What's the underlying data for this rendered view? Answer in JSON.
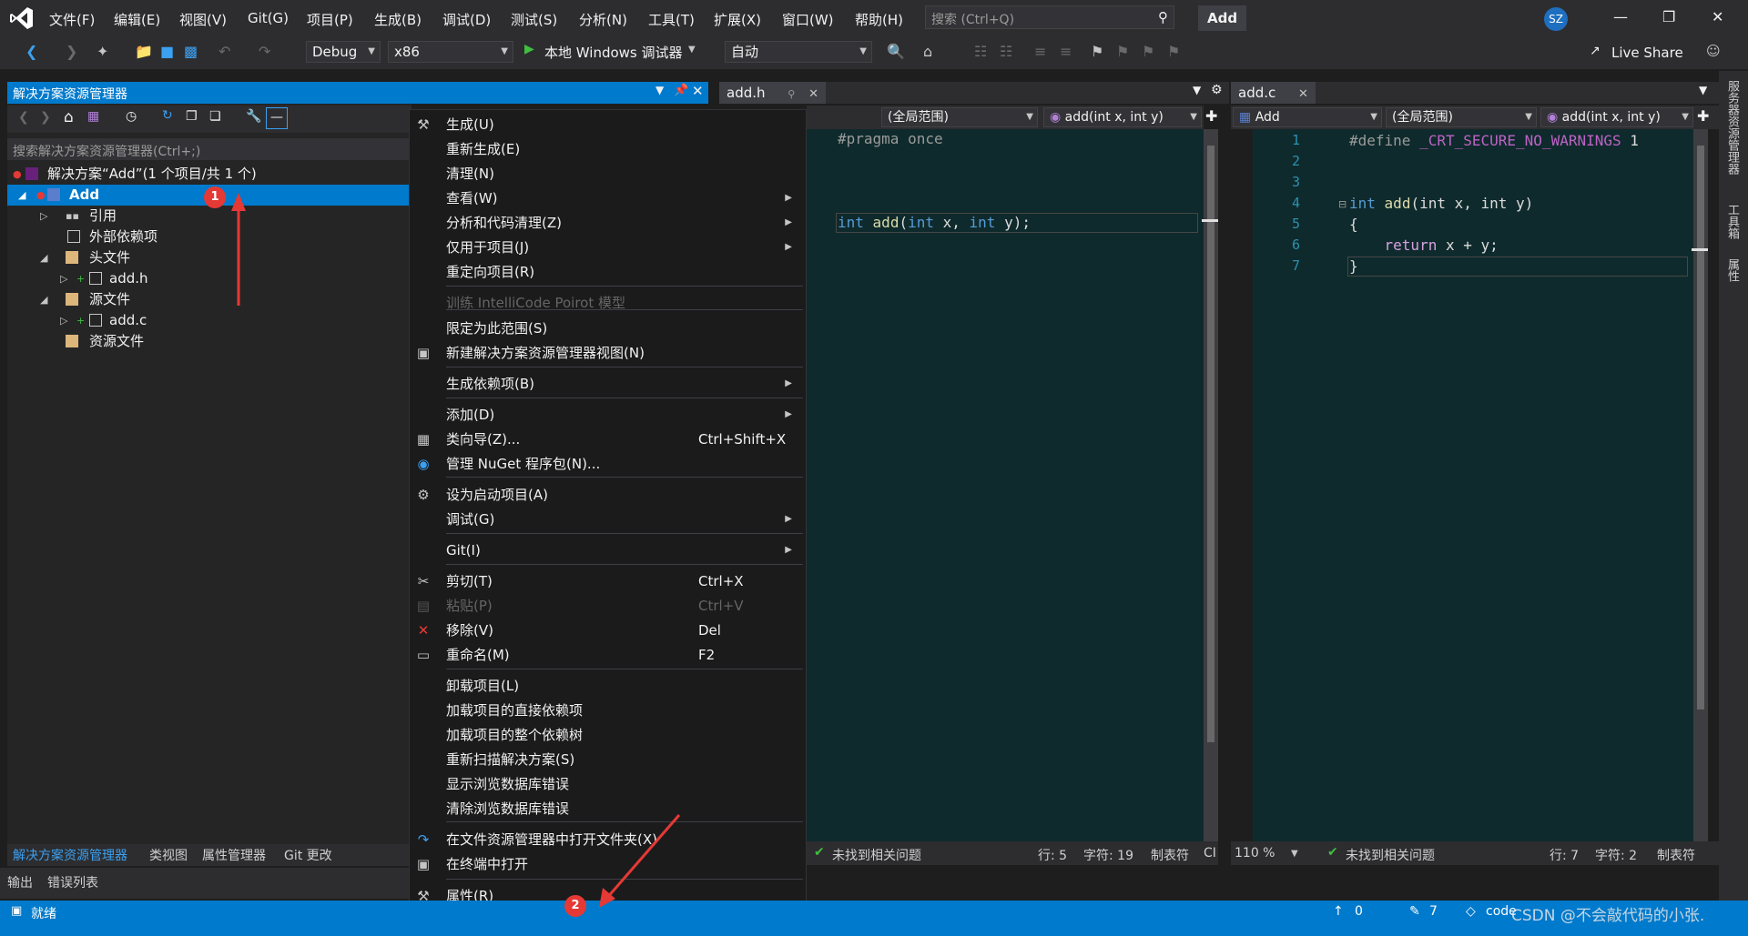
{
  "menubar": {
    "items": [
      "文件(F)",
      "编辑(E)",
      "视图(V)",
      "Git(G)",
      "项目(P)",
      "生成(B)",
      "调试(D)",
      "测试(S)",
      "分析(N)",
      "工具(T)",
      "扩展(X)",
      "窗口(W)",
      "帮助(H)"
    ],
    "search_placeholder": "搜索 (Ctrl+Q)",
    "solution_name": "Add",
    "avatar": "SZ"
  },
  "toolbar": {
    "config": "Debug",
    "platform": "x86",
    "run_label": "本地 Windows 调试器",
    "auto": "自动",
    "live_share": "Live Share"
  },
  "solution_explorer": {
    "title": "解决方案资源管理器",
    "search_placeholder": "搜索解决方案资源管理器(Ctrl+;)",
    "tree": [
      {
        "label": "解决方案“Add”(1 个项目/共 1 个)"
      },
      {
        "label": "Add"
      },
      {
        "label": "引用"
      },
      {
        "label": "外部依赖项"
      },
      {
        "label": "头文件"
      },
      {
        "label": "add.h"
      },
      {
        "label": "源文件"
      },
      {
        "label": "add.c"
      },
      {
        "label": "资源文件"
      }
    ],
    "tabs": [
      "解决方案资源管理器",
      "类视图",
      "属性管理器",
      "Git 更改"
    ]
  },
  "bottom_tabs": [
    "输出",
    "错误列表"
  ],
  "editor_left": {
    "tab": "add.h",
    "scope": "(全局范围)",
    "func": "add(int x, int y)",
    "lines": [
      "#pragma once",
      "int add(int x, int y);"
    ],
    "status": "未找到相关问题",
    "row": "行: 5",
    "col": "字符: 19",
    "tabs_mode": "制表符",
    "crlf": "CI"
  },
  "editor_right": {
    "tab": "add.c",
    "project": "Add",
    "scope": "(全局范围)",
    "func": "add(int x, int y)",
    "line_numbers": [
      "1",
      "2",
      "3",
      "4",
      "5",
      "6",
      "7"
    ],
    "line1_directive": "#define",
    "line1_macro": "_CRT_SECURE_NO_WARNINGS",
    "line1_value": "1",
    "line4_kw": "int",
    "line4_fn": "add",
    "line4_rest": "(int x, int y)",
    "line5": "{",
    "line6_kw": "return",
    "line6_rest": " x + y;",
    "line7": "}",
    "zoom": "110 %",
    "status": "未找到相关问题",
    "row": "行: 7",
    "col": "字符: 2",
    "tabs_mode": "制表符"
  },
  "context_menu": {
    "items": [
      {
        "label": "生成(U)",
        "icon": "build-icon"
      },
      {
        "label": "重新生成(E)"
      },
      {
        "label": "清理(N)"
      },
      {
        "label": "查看(W)",
        "submenu": true
      },
      {
        "label": "分析和代码清理(Z)",
        "submenu": true
      },
      {
        "label": "仅用于项目(J)",
        "submenu": true
      },
      {
        "label": "重定向项目(R)"
      },
      {
        "label": "训练 IntelliCode Poirot 模型",
        "disabled": true
      },
      {
        "label": "限定为此范围(S)"
      },
      {
        "label": "新建解决方案资源管理器视图(N)",
        "icon": "new-view-icon"
      },
      {
        "label": "生成依赖项(B)",
        "submenu": true
      },
      {
        "label": "添加(D)",
        "submenu": true
      },
      {
        "label": "类向导(Z)...",
        "shortcut": "Ctrl+Shift+X",
        "icon": "class-wizard-icon"
      },
      {
        "label": "管理 NuGet 程序包(N)...",
        "icon": "nuget-icon"
      },
      {
        "label": "设为启动项目(A)",
        "icon": "gear-icon"
      },
      {
        "label": "调试(G)",
        "submenu": true
      },
      {
        "label": "Git(I)",
        "submenu": true
      },
      {
        "label": "剪切(T)",
        "shortcut": "Ctrl+X",
        "icon": "cut-icon"
      },
      {
        "label": "粘贴(P)",
        "shortcut": "Ctrl+V",
        "disabled": true,
        "icon": "paste-icon"
      },
      {
        "label": "移除(V)",
        "shortcut": "Del",
        "icon": "remove-icon"
      },
      {
        "label": "重命名(M)",
        "shortcut": "F2",
        "icon": "rename-icon"
      },
      {
        "label": "卸载项目(L)"
      },
      {
        "label": "加载项目的直接依赖项"
      },
      {
        "label": "加载项目的整个依赖树"
      },
      {
        "label": "重新扫描解决方案(S)"
      },
      {
        "label": "显示浏览数据库错误"
      },
      {
        "label": "清除浏览数据库错误"
      },
      {
        "label": "在文件资源管理器中打开文件夹(X)",
        "icon": "open-folder-icon"
      },
      {
        "label": "在终端中打开",
        "icon": "terminal-icon"
      },
      {
        "label": "属性(R)",
        "icon": "wrench-icon"
      }
    ]
  },
  "status_bar": {
    "ready": "就绪",
    "up_count": "0",
    "edit_count": "7",
    "branch": "code",
    "watermark": "CSDN @不会敲代码的小张."
  },
  "right_rail": [
    "服务器资源管理器",
    "工具箱",
    "属性"
  ],
  "annotations": [
    "1",
    "2"
  ],
  "colors": {
    "accent": "#007acc",
    "badge": "#e53935",
    "editor_bg": "#0f2a2c"
  }
}
